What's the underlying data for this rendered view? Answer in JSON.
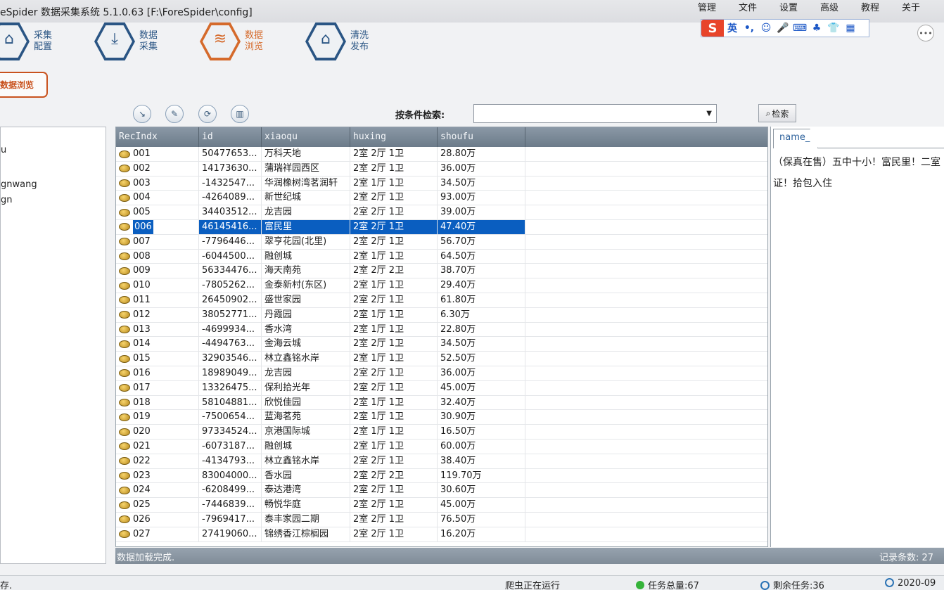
{
  "titlebar": {
    "title": "eSpider 数据采集系统  5.1.0.63  [F:\\ForeSpider\\config]",
    "menu": [
      "管理",
      "文件",
      "设置",
      "高级",
      "教程",
      "关于"
    ]
  },
  "ime": {
    "logo": "S",
    "lang": "英",
    "punct": "•,",
    "emoji": "☺",
    "mic": "🎤",
    "keyboard": "⌨",
    "tools": "♣",
    "skin": "👕",
    "grid": "▦"
  },
  "chat_icon": "•••",
  "nav": [
    {
      "icon": "⌂",
      "label": "采集配置"
    },
    {
      "icon": "⤓",
      "label": "数据采集"
    },
    {
      "icon": "≋",
      "label": "数据浏览"
    },
    {
      "icon": "⌂",
      "label": "清洗发布"
    }
  ],
  "tab": {
    "label": "数据浏览"
  },
  "tree": [
    "u",
    "gnwang",
    "gn"
  ],
  "toolbar": {
    "icons": [
      "↘",
      "✎",
      "⟳",
      "▥"
    ],
    "search_label": "按条件检索:",
    "search_value": "",
    "search_button": "检索",
    "search_icon": "⌕"
  },
  "grid": {
    "columns": [
      "RecIndx",
      "id",
      "xiaoqu",
      "huxing",
      "shoufu"
    ],
    "rows": [
      [
        "001",
        "50477653...",
        "万科天地",
        "2室 2厅 1卫",
        "28.80万"
      ],
      [
        "002",
        "14173630...",
        "蒲瑞祥园西区",
        "2室 2厅 1卫",
        "36.00万"
      ],
      [
        "003",
        "-1432547...",
        "华润橡树湾茗润轩",
        "2室 1厅 1卫",
        "34.50万"
      ],
      [
        "004",
        "-4264089...",
        "新世纪城",
        "2室 2厅 1卫",
        "93.00万"
      ],
      [
        "005",
        "34403512...",
        "龙吉园",
        "2室 2厅 1卫",
        "39.00万"
      ],
      [
        "006",
        "46145416...",
        "富民里",
        "2室 2厅 1卫",
        "47.40万"
      ],
      [
        "007",
        "-7796446...",
        "翠亨花园(北里)",
        "2室 2厅 1卫",
        "56.70万"
      ],
      [
        "008",
        "-6044500...",
        "融创城",
        "2室 1厅 1卫",
        "64.50万"
      ],
      [
        "009",
        "56334476...",
        "海天南苑",
        "2室 2厅 2卫",
        "38.70万"
      ],
      [
        "010",
        "-7805262...",
        "金泰新村(东区)",
        "2室 1厅 1卫",
        "29.40万"
      ],
      [
        "011",
        "26450902...",
        "盛世家园",
        "2室 2厅 1卫",
        "61.80万"
      ],
      [
        "012",
        "38052771...",
        "丹霞园",
        "2室 1厅 1卫",
        "6.30万"
      ],
      [
        "013",
        "-4699934...",
        "香水湾",
        "2室 1厅 1卫",
        "22.80万"
      ],
      [
        "014",
        "-4494763...",
        "金海云城",
        "2室 2厅 1卫",
        "34.50万"
      ],
      [
        "015",
        "32903546...",
        "林立鑫铭水岸",
        "2室 1厅 1卫",
        "52.50万"
      ],
      [
        "016",
        "18989049...",
        "龙吉园",
        "2室 2厅 1卫",
        "36.00万"
      ],
      [
        "017",
        "13326475...",
        "保利拾光年",
        "2室 2厅 1卫",
        "45.00万"
      ],
      [
        "018",
        "58104881...",
        "欣悦佳园",
        "2室 1厅 1卫",
        "32.40万"
      ],
      [
        "019",
        "-7500654...",
        "蓝海茗苑",
        "2室 1厅 1卫",
        "30.90万"
      ],
      [
        "020",
        "97334524...",
        "京港国际城",
        "2室 1厅 1卫",
        "16.50万"
      ],
      [
        "021",
        "-6073187...",
        "融创城",
        "2室 1厅 1卫",
        "60.00万"
      ],
      [
        "022",
        "-4134793...",
        "林立鑫铭水岸",
        "2室 2厅 1卫",
        "38.40万"
      ],
      [
        "023",
        "83004000...",
        "香水园",
        "2室 2厅 2卫",
        "119.70万"
      ],
      [
        "024",
        "-6208499...",
        "泰达港湾",
        "2室 2厅 1卫",
        "30.60万"
      ],
      [
        "025",
        "-7446839...",
        "畅悦华庭",
        "2室 2厅 1卫",
        "45.00万"
      ],
      [
        "026",
        "-7969417...",
        "泰丰家园二期",
        "2室 2厅 1卫",
        "76.50万"
      ],
      [
        "027",
        "27419060...",
        "锦绣香江棕榈园",
        "2室 2厅 1卫",
        "16.20万"
      ]
    ],
    "selected_row": "006",
    "status": "数据加载完成.",
    "record_label": "记录条数: 27"
  },
  "detail": {
    "tab": "name_",
    "text": "（保真在售）五中十小！富民里！二室证！拾包入住"
  },
  "statusbar": {
    "left": "存.",
    "running": "爬虫正在运行",
    "total": "任务总量:67",
    "remaining": "剩余任务:36",
    "date": "2020-09"
  }
}
